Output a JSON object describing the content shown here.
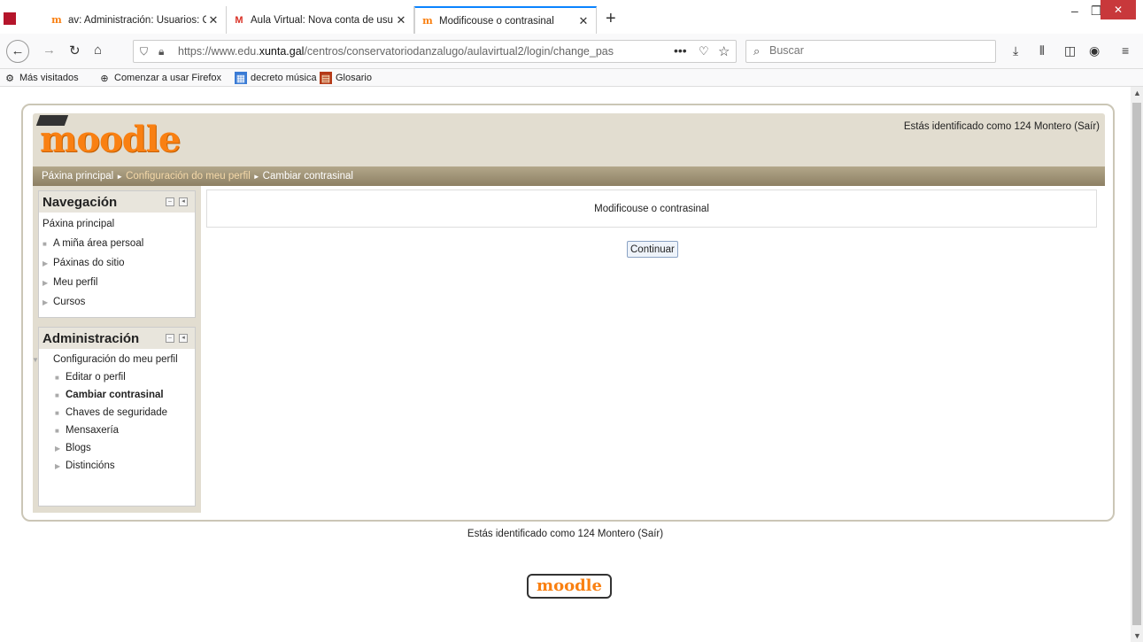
{
  "browser": {
    "tabs": [
      {
        "title": "av: Administración: Usuarios: C",
        "icon": "moodle-icon"
      },
      {
        "title": "Aula Virtual: Nova conta de usu",
        "icon": "gmail-icon"
      },
      {
        "title": "Modificouse o contrasinal",
        "icon": "moodle-icon"
      }
    ],
    "url_prefix": "https://www.edu.",
    "url_domain": "xunta.gal",
    "url_path": "/centros/conservatoriodanzalugo/aulavirtual2/login/change_pas",
    "search_placeholder": "Buscar",
    "bookmarks": [
      {
        "label": "Más visitados"
      },
      {
        "label": "Comenzar a usar Firefox"
      },
      {
        "label": "decreto música"
      },
      {
        "label": "Glosario"
      }
    ]
  },
  "moodle": {
    "logo": "moodle",
    "login_info": "Estás identificado como 124 Montero (Saír)",
    "breadcrumb": [
      "Páxina principal",
      "Configuración do meu perfil",
      "Cambiar contrasinal"
    ],
    "navigation": {
      "title": "Navegación",
      "items": [
        "Páxina principal",
        "A miña área persoal",
        "Páxinas do sitio",
        "Meu perfil",
        "Cursos"
      ]
    },
    "administration": {
      "title": "Administración",
      "section": "Configuración do meu perfil",
      "items": [
        "Editar o perfil",
        "Cambiar contrasinal",
        "Chaves de seguridade",
        "Mensaxería",
        "Blogs",
        "Distincións"
      ]
    },
    "notice": "Modificouse o contrasinal",
    "continue_label": "Continuar",
    "footer_login": "Estás identificado como 124 Montero (Saír)",
    "footer_logo": "moodle"
  }
}
